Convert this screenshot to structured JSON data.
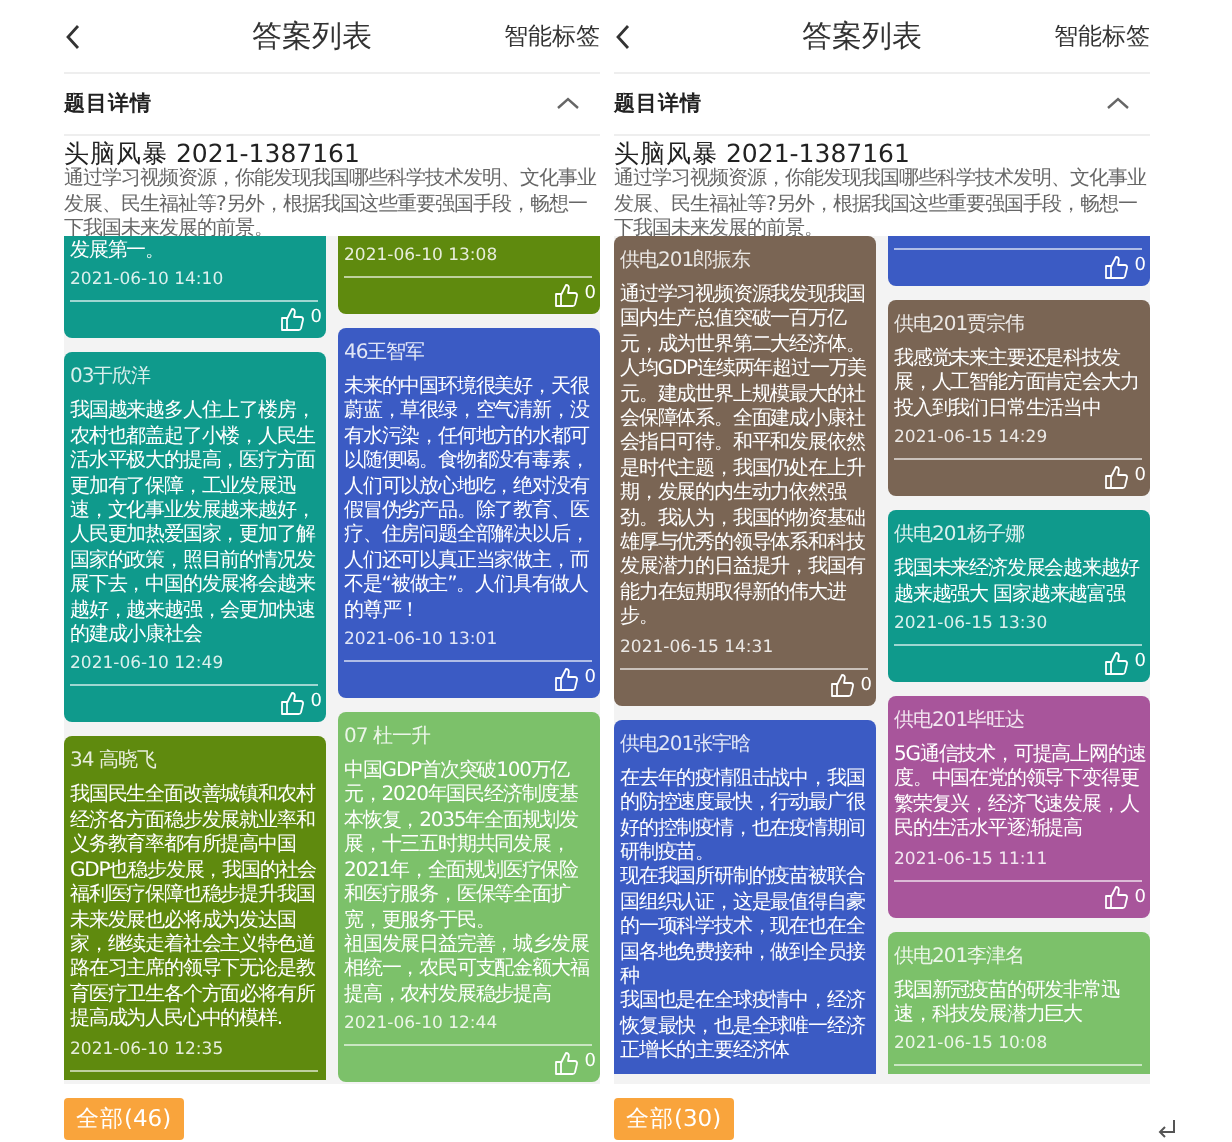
{
  "screens": [
    {
      "header": {
        "title": "答案列表",
        "action": "智能标签"
      },
      "section": {
        "title": "题目详情",
        "expanded": true
      },
      "question": {
        "title": "头脑风暴 2021-1387161",
        "description": "通过学习视频资源，你能发现我国哪些科学技术发明、文化事业发展、民生福祉等?另外，根据我国这些重要强国手段，畅想一下我国未来发展的前景。"
      },
      "columns": [
        [
          {
            "kind": "cut_top",
            "color": "#0f9a8c",
            "text": [
              "发展第一。"
            ],
            "time": "2021-06-10 14:10",
            "likes": "0"
          },
          {
            "kind": "full",
            "color": "#0f9a8c",
            "author": "03于欣洋",
            "text": [
              "我国越来越多人住上了楼房，农村也都盖起了小楼，人民生活水平极大的提高，医疗方面更加有了保障，工业发展迅速，文化事业发展越来越好，人民更加热爱国家，更加了解国家的政策，照目前的情况发展下去，中国的发展将会越来越好，越来越强，会更加快速的建成小康社会"
            ],
            "time": "2021-06-10 12:49",
            "likes": "0"
          },
          {
            "kind": "cut_bottom",
            "color": "#5f8a0e",
            "author": "34 高晓飞",
            "text": [
              "我国民生全面改善城镇和农村经济各方面稳步发展就业率和义务教育率都有所提高中国GDP也稳步发展，我国的社会福利医疗保障也稳步提升我国未来发展也必将成为发达国家，继续走着社会主义特色道路在习主席的领导下无论是教育医疗卫生各个方面必将有所提高成为人民心中的模样."
            ],
            "time": "2021-06-10 12:35"
          }
        ],
        [
          {
            "kind": "cut_top",
            "color": "#5f8a0e",
            "time": "2021-06-10 13:08",
            "likes": "0"
          },
          {
            "kind": "full",
            "color": "#3b5bc4",
            "author": "46王智军",
            "text": [
              "未来的中国环境很美好，天很蔚蓝，草很绿，空气清新，没有水污染，任何地方的水都可以随便喝。食物都没有毒素，人们可以放心地吃，绝对没有假冒伪劣产品。除了教育、医疗、住房问题全部解决以后，人们还可以真正当家做主，而不是“被做主”。人们具有做人的尊严！"
            ],
            "time": "2021-06-10 13:01",
            "likes": "0"
          },
          {
            "kind": "full",
            "color": "#7cc16a",
            "author": "07 杜一升",
            "text": [
              "中国GDP首次突破100万亿元，2020年国民经济制度基本恢复，2035年全面规划发展，十三五时期共同发展，2021年，全面规划医疗保险和医疗服务，医保等全面扩宽，更服务于民。",
              "祖国发展日益完善，城乡发展相统一，农民可支配金额大福提高，农村发展稳步提高"
            ],
            "time": "2021-06-10 12:44",
            "likes": "0"
          }
        ]
      ],
      "filter_button": "全部(46)"
    },
    {
      "header": {
        "title": "答案列表",
        "action": "智能标签"
      },
      "section": {
        "title": "题目详情",
        "expanded": true
      },
      "question": {
        "title": "头脑风暴 2021-1387161",
        "description": "通过学习视频资源，你能发现我国哪些科学技术发明、文化事业发展、民生福祉等?另外，根据我国这些重要强国手段，畅想一下我国未来发展的前景。"
      },
      "columns": [
        [
          {
            "kind": "full",
            "color": "#7a6554",
            "author": "供电201郎振东",
            "text": [
              "通过学习视频资源我发现我国国内生产总值突破一百万亿元，成为世界第二大经济体。人均GDP连续两年超过一万美元。建成世界上规模最大的社会保障体系。全面建成小康社会指日可待。和平和发展依然是时代主题，我国仍处在上升期，发展的内生动力依然强劲。我认为，我国的物资基础雄厚与优秀的领导体系和科技发展潜力的日益提升，我国有能力在短期取得新的伟大进步。"
            ],
            "time": "2021-06-15 14:31",
            "likes": "0"
          },
          {
            "kind": "cut_bottom",
            "color": "#3b5bc4",
            "author": "供电201张宇晗",
            "text": [
              "在去年的疫情阻击战中，我国的防控速度最快，行动最广很好的控制疫情，也在疫情期间研制疫苗。",
              "现在我国所研制的疫苗被联合国组织认证，这是最值得自豪的一项科学技术，现在也在全国各地免费接种，做到全员接种",
              "我国也是在全球疫情中，经济恢复最快，也是全球唯一经济正增长的主要经济体"
            ]
          }
        ],
        [
          {
            "kind": "cut_top",
            "color": "#3b5bc4",
            "likes": "0"
          },
          {
            "kind": "full",
            "color": "#7a6554",
            "author": "供电201贾宗伟",
            "text": [
              "我感觉未来主要还是科技发展，人工智能方面肯定会大力投入到我们日常生活当中"
            ],
            "time": "2021-06-15 14:29",
            "likes": "0"
          },
          {
            "kind": "full",
            "color": "#0f9a8c",
            "author": "供电201杨子娜",
            "text": [
              "我国未来经济发展会越来越好越来越强大 国家越来越富强"
            ],
            "time": "2021-06-15 13:30",
            "likes": "0"
          },
          {
            "kind": "full",
            "color": "#a8559b",
            "author": "供电201毕旺达",
            "text": [
              "5G通信技术，可提高上网的速度。中国在党的领导下变得更繁荣复兴，经济飞速发展，人民的生活水平逐渐提高"
            ],
            "time": "2021-06-15 11:11",
            "likes": "0"
          },
          {
            "kind": "cut_bottom",
            "color": "#7cc16a",
            "author": "供电201李津名",
            "text": [
              "我国新冠疫苗的研发非常迅速，科技发展潜力巨大"
            ],
            "time": "2021-06-15 10:08"
          }
        ]
      ],
      "filter_button": "全部(30)"
    }
  ]
}
